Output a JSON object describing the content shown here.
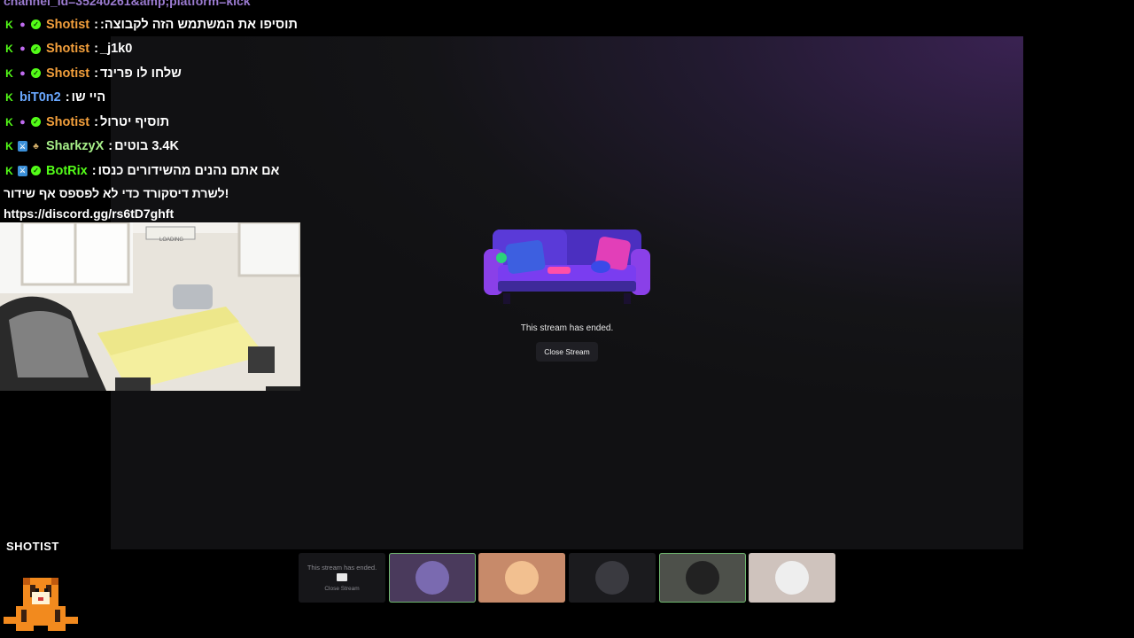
{
  "chat": {
    "header_url": "channel_id=35240261&amp;platform=kick",
    "messages": [
      {
        "user": "Shotist",
        "user_color": "#f4a03c",
        "badges": [
          "kick-icon",
          "mic-icon",
          "verified-icon"
        ],
        "text": "תוסיפו את המשתמש הזה לקבוצה:"
      },
      {
        "user": "Shotist",
        "user_color": "#f4a03c",
        "badges": [
          "kick-icon",
          "mic-icon",
          "verified-icon"
        ],
        "text": "j1k0_"
      },
      {
        "user": "Shotist",
        "user_color": "#f4a03c",
        "badges": [
          "kick-icon",
          "mic-icon",
          "verified-icon"
        ],
        "text": "שלחו לו פרינד"
      },
      {
        "user": "biT0n2",
        "user_color": "#6aa8ff",
        "badges": [
          "kick-icon"
        ],
        "text": "היי שו"
      },
      {
        "user": "Shotist",
        "user_color": "#f4a03c",
        "badges": [
          "kick-icon",
          "mic-icon",
          "verified-icon"
        ],
        "text": "תוסיף יטרול"
      },
      {
        "user": "SharkzyX",
        "user_color": "#a8f08a",
        "badges": [
          "kick-icon",
          "mod-icon",
          "gift-icon"
        ],
        "text": "3.4K בוטים"
      },
      {
        "user": "BotRix",
        "user_color": "#53fc18",
        "badges": [
          "kick-icon",
          "mod-icon",
          "verified-icon"
        ],
        "text": "אם אתם נהנים מהשידורים כנסו"
      }
    ],
    "continuation": [
      "לשרת דיסקורד כדי לא לפספס אף שידור!",
      "https://discord.gg/rs6tD7ghft"
    ]
  },
  "camera": {
    "sign_text": "LOADING"
  },
  "stage": {
    "ended_text": "This stream has ended.",
    "close_label": "Close Stream"
  },
  "thumbnails": [
    {
      "type": "ended",
      "text": "This stream has ended.",
      "button": "Close Stream"
    },
    {
      "type": "avatar",
      "bg": "#4a3a5c",
      "color": "#7a6ab0",
      "selected": true
    },
    {
      "type": "avatar",
      "bg": "#c78a6a",
      "color": "#f2c090"
    },
    {
      "type": "avatar",
      "bg": "#1b1b1e",
      "color": "#3a3a40"
    },
    {
      "type": "avatar",
      "bg": "#4d504a",
      "color": "#222",
      "selected": true
    },
    {
      "type": "avatar",
      "bg": "#cfc3bd",
      "color": "#eee"
    }
  ],
  "branding": {
    "name": "SHOTIST"
  },
  "colors": {
    "accent": "#53fc18",
    "stage_purple": "#3a2252"
  }
}
